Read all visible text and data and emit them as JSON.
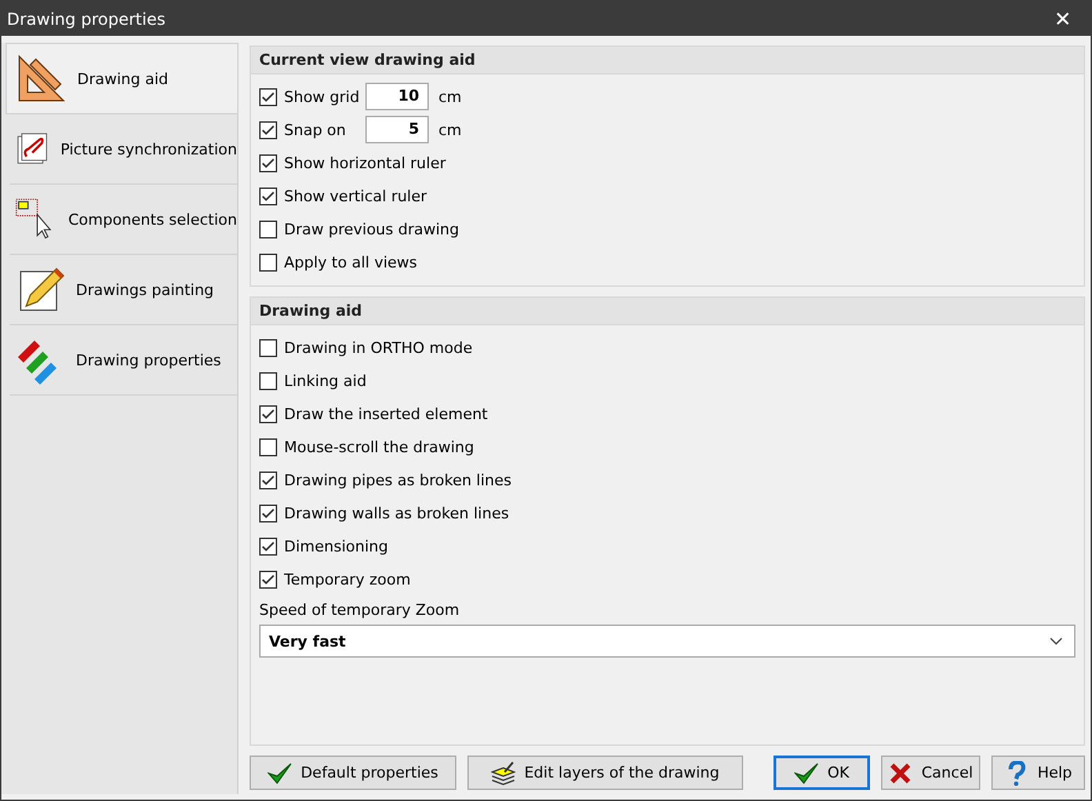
{
  "window": {
    "title": "Drawing properties",
    "close": "✕"
  },
  "sidebar": {
    "items": [
      {
        "label": "Drawing aid",
        "selected": true
      },
      {
        "label": "Picture synchronization",
        "selected": false
      },
      {
        "label": "Components selection",
        "selected": false
      },
      {
        "label": "Drawings painting",
        "selected": false
      },
      {
        "label": "Drawing properties",
        "selected": false
      }
    ]
  },
  "current_view": {
    "title": "Current view drawing aid",
    "options": [
      {
        "kind": "value",
        "label": "Show grid",
        "checked": true,
        "value": "10",
        "unit": "cm"
      },
      {
        "kind": "value",
        "label": "Snap on",
        "checked": true,
        "value": "5",
        "unit": "cm"
      },
      {
        "kind": "check",
        "label": "Show horizontal ruler",
        "checked": true
      },
      {
        "kind": "check",
        "label": "Show vertical ruler",
        "checked": true
      },
      {
        "kind": "check",
        "label": "Draw previous drawing",
        "checked": false
      },
      {
        "kind": "check",
        "label": "Apply to all views",
        "checked": false
      }
    ]
  },
  "drawing_aid": {
    "title": "Drawing aid",
    "options": [
      {
        "label": "Drawing in ORTHO mode",
        "checked": false
      },
      {
        "label": "Linking aid",
        "checked": false
      },
      {
        "label": "Draw the inserted element",
        "checked": true
      },
      {
        "label": "Mouse-scroll the drawing",
        "checked": false
      },
      {
        "label": "Drawing pipes as broken lines",
        "checked": true
      },
      {
        "label": "Drawing walls as broken lines",
        "checked": true
      },
      {
        "label": "Dimensioning",
        "checked": true
      },
      {
        "label": "Temporary zoom",
        "checked": true
      }
    ],
    "speed_label": "Speed of temporary Zoom",
    "speed_value": "Very fast"
  },
  "buttons": [
    {
      "label": "Default properties",
      "default": false
    },
    {
      "label": "Edit layers of the drawing",
      "default": false
    },
    {
      "label": "OK",
      "default": true
    },
    {
      "label": "Cancel",
      "default": false
    },
    {
      "label": "Help",
      "default": false
    }
  ]
}
